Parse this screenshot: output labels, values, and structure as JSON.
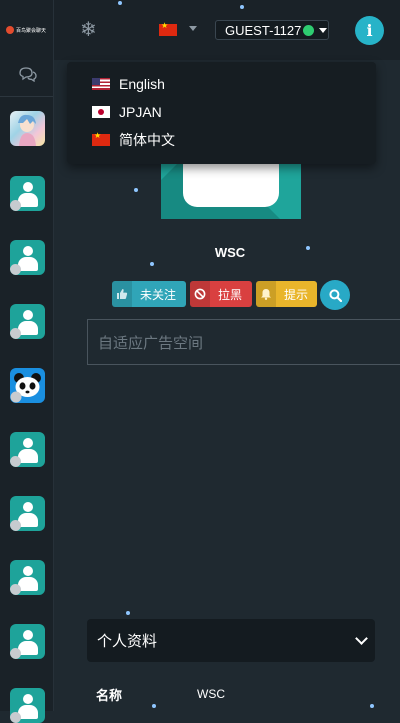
{
  "brand": {
    "logo_text": "百鸟聚会聊天"
  },
  "topbar": {
    "guest_name": "GUEST-1127",
    "info_label": "i"
  },
  "language_menu": {
    "items": [
      {
        "label": "English",
        "flag": "us-flag"
      },
      {
        "label": "JPJAN",
        "flag": "jp-flag"
      },
      {
        "label": "简体中文",
        "flag": "cn-flag"
      }
    ]
  },
  "profile": {
    "name": "WSC",
    "buttons": {
      "follow": "未关注",
      "block": "拉黑",
      "remind": "提示"
    }
  },
  "ad": {
    "text": "自适应广告空间"
  },
  "details": {
    "section_title": "个人资料",
    "fields": [
      {
        "key": "名称",
        "value": "WSC"
      }
    ]
  },
  "colors": {
    "accent_teal": "#1ea39a",
    "info_blue": "#27b3c8",
    "danger_red": "#d94040",
    "warning_yellow": "#e9b52b",
    "online_green": "#2ecc71"
  }
}
